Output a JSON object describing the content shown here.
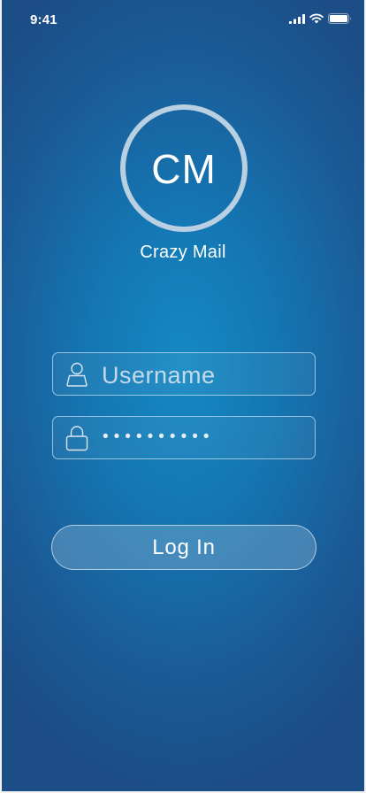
{
  "status_bar": {
    "time": "9:41"
  },
  "logo": {
    "initials": "CM",
    "app_name": "Crazy Mail"
  },
  "login_form": {
    "username_placeholder": "Username",
    "password_value": "••••••••••",
    "login_label": "Log In"
  },
  "colors": {
    "background_center": "#1589c3",
    "background_edge": "#1c4d86",
    "logo_ring": "#b9cfe2",
    "text": "#ffffff"
  },
  "icons": {
    "username_field": "user-icon",
    "password_field": "lock-icon",
    "status": [
      "signal-icon",
      "wifi-icon",
      "battery-icon"
    ]
  }
}
